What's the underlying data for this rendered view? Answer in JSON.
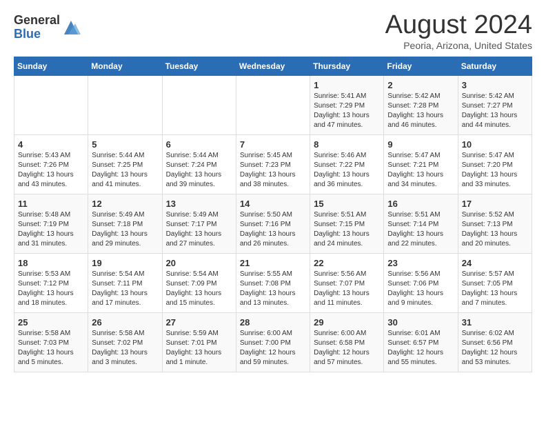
{
  "logo": {
    "general": "General",
    "blue": "Blue"
  },
  "header": {
    "month": "August 2024",
    "location": "Peoria, Arizona, United States"
  },
  "days_of_week": [
    "Sunday",
    "Monday",
    "Tuesday",
    "Wednesday",
    "Thursday",
    "Friday",
    "Saturday"
  ],
  "weeks": [
    [
      {
        "day": "",
        "content": ""
      },
      {
        "day": "",
        "content": ""
      },
      {
        "day": "",
        "content": ""
      },
      {
        "day": "",
        "content": ""
      },
      {
        "day": "1",
        "content": "Sunrise: 5:41 AM\nSunset: 7:29 PM\nDaylight: 13 hours\nand 47 minutes."
      },
      {
        "day": "2",
        "content": "Sunrise: 5:42 AM\nSunset: 7:28 PM\nDaylight: 13 hours\nand 46 minutes."
      },
      {
        "day": "3",
        "content": "Sunrise: 5:42 AM\nSunset: 7:27 PM\nDaylight: 13 hours\nand 44 minutes."
      }
    ],
    [
      {
        "day": "4",
        "content": "Sunrise: 5:43 AM\nSunset: 7:26 PM\nDaylight: 13 hours\nand 43 minutes."
      },
      {
        "day": "5",
        "content": "Sunrise: 5:44 AM\nSunset: 7:25 PM\nDaylight: 13 hours\nand 41 minutes."
      },
      {
        "day": "6",
        "content": "Sunrise: 5:44 AM\nSunset: 7:24 PM\nDaylight: 13 hours\nand 39 minutes."
      },
      {
        "day": "7",
        "content": "Sunrise: 5:45 AM\nSunset: 7:23 PM\nDaylight: 13 hours\nand 38 minutes."
      },
      {
        "day": "8",
        "content": "Sunrise: 5:46 AM\nSunset: 7:22 PM\nDaylight: 13 hours\nand 36 minutes."
      },
      {
        "day": "9",
        "content": "Sunrise: 5:47 AM\nSunset: 7:21 PM\nDaylight: 13 hours\nand 34 minutes."
      },
      {
        "day": "10",
        "content": "Sunrise: 5:47 AM\nSunset: 7:20 PM\nDaylight: 13 hours\nand 33 minutes."
      }
    ],
    [
      {
        "day": "11",
        "content": "Sunrise: 5:48 AM\nSunset: 7:19 PM\nDaylight: 13 hours\nand 31 minutes."
      },
      {
        "day": "12",
        "content": "Sunrise: 5:49 AM\nSunset: 7:18 PM\nDaylight: 13 hours\nand 29 minutes."
      },
      {
        "day": "13",
        "content": "Sunrise: 5:49 AM\nSunset: 7:17 PM\nDaylight: 13 hours\nand 27 minutes."
      },
      {
        "day": "14",
        "content": "Sunrise: 5:50 AM\nSunset: 7:16 PM\nDaylight: 13 hours\nand 26 minutes."
      },
      {
        "day": "15",
        "content": "Sunrise: 5:51 AM\nSunset: 7:15 PM\nDaylight: 13 hours\nand 24 minutes."
      },
      {
        "day": "16",
        "content": "Sunrise: 5:51 AM\nSunset: 7:14 PM\nDaylight: 13 hours\nand 22 minutes."
      },
      {
        "day": "17",
        "content": "Sunrise: 5:52 AM\nSunset: 7:13 PM\nDaylight: 13 hours\nand 20 minutes."
      }
    ],
    [
      {
        "day": "18",
        "content": "Sunrise: 5:53 AM\nSunset: 7:12 PM\nDaylight: 13 hours\nand 18 minutes."
      },
      {
        "day": "19",
        "content": "Sunrise: 5:54 AM\nSunset: 7:11 PM\nDaylight: 13 hours\nand 17 minutes."
      },
      {
        "day": "20",
        "content": "Sunrise: 5:54 AM\nSunset: 7:09 PM\nDaylight: 13 hours\nand 15 minutes."
      },
      {
        "day": "21",
        "content": "Sunrise: 5:55 AM\nSunset: 7:08 PM\nDaylight: 13 hours\nand 13 minutes."
      },
      {
        "day": "22",
        "content": "Sunrise: 5:56 AM\nSunset: 7:07 PM\nDaylight: 13 hours\nand 11 minutes."
      },
      {
        "day": "23",
        "content": "Sunrise: 5:56 AM\nSunset: 7:06 PM\nDaylight: 13 hours\nand 9 minutes."
      },
      {
        "day": "24",
        "content": "Sunrise: 5:57 AM\nSunset: 7:05 PM\nDaylight: 13 hours\nand 7 minutes."
      }
    ],
    [
      {
        "day": "25",
        "content": "Sunrise: 5:58 AM\nSunset: 7:03 PM\nDaylight: 13 hours\nand 5 minutes."
      },
      {
        "day": "26",
        "content": "Sunrise: 5:58 AM\nSunset: 7:02 PM\nDaylight: 13 hours\nand 3 minutes."
      },
      {
        "day": "27",
        "content": "Sunrise: 5:59 AM\nSunset: 7:01 PM\nDaylight: 13 hours\nand 1 minute."
      },
      {
        "day": "28",
        "content": "Sunrise: 6:00 AM\nSunset: 7:00 PM\nDaylight: 12 hours\nand 59 minutes."
      },
      {
        "day": "29",
        "content": "Sunrise: 6:00 AM\nSunset: 6:58 PM\nDaylight: 12 hours\nand 57 minutes."
      },
      {
        "day": "30",
        "content": "Sunrise: 6:01 AM\nSunset: 6:57 PM\nDaylight: 12 hours\nand 55 minutes."
      },
      {
        "day": "31",
        "content": "Sunrise: 6:02 AM\nSunset: 6:56 PM\nDaylight: 12 hours\nand 53 minutes."
      }
    ]
  ]
}
